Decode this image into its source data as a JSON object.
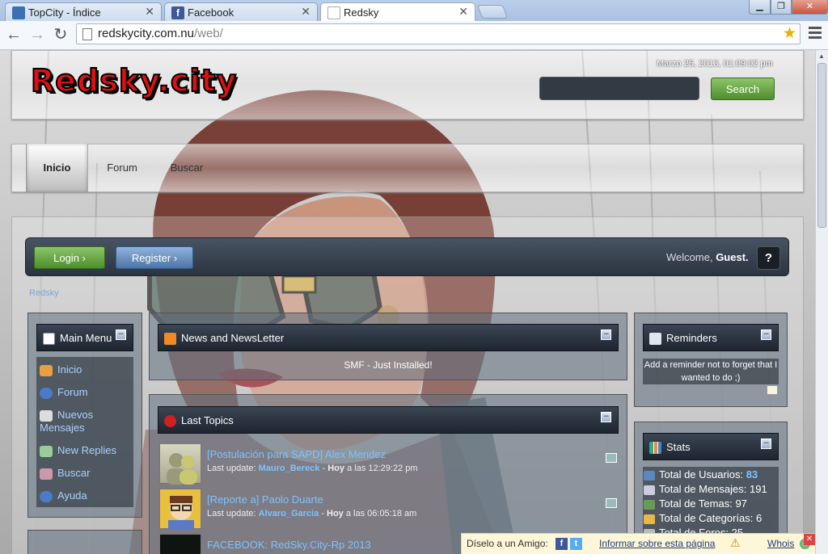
{
  "browser": {
    "tabs": [
      {
        "title": "TopCity - Índice"
      },
      {
        "title": "Facebook"
      },
      {
        "title": "Redsky"
      }
    ],
    "url_host": "redskycity.com.nu",
    "url_path": "/web/"
  },
  "site": {
    "logo_text": "Redsky.city",
    "datetime": "Marzo 25, 2013, 01:09:02 pm",
    "search_button": "Search",
    "nav": [
      "Inicio",
      "Forum",
      "Buscar"
    ],
    "login": "Login",
    "register": "Register",
    "welcome_prefix": "Welcome,",
    "welcome_user": "Guest.",
    "help": "?",
    "breadcrumb": "Redsky"
  },
  "main_menu": {
    "title": "Main Menu",
    "items": [
      "Inicio",
      "Forum",
      "Nuevos Mensajes",
      "New Replies",
      "Buscar",
      "Ayuda"
    ]
  },
  "news": {
    "title": "News and NewsLetter",
    "body": "SMF - Just Installed!"
  },
  "last_topics": {
    "title": "Last Topics",
    "items": [
      {
        "title": "[Postulación para SAPD] Alex Mendez",
        "label": "Last update:",
        "user": "Mauro_Bereck",
        "day": "Hoy",
        "time": "a las 12:29:22 pm"
      },
      {
        "title": "[Reporte a] Paolo Duarte",
        "label": "Last update:",
        "user": "Alvaro_Garcia",
        "day": "Hoy",
        "time": "a las 06:05:18 am"
      },
      {
        "title": "FACEBOOK: RedSky.City-Rp 2013"
      }
    ]
  },
  "reminders": {
    "title": "Reminders",
    "body": "Add a reminder not to forget that I wanted to do ;)"
  },
  "stats": {
    "title": "Stats",
    "rows": [
      {
        "label": "Total de Usuarios:",
        "value": "83"
      },
      {
        "label": "Total de Mensajes:",
        "value": "191"
      },
      {
        "label": "Total de Temas:",
        "value": "97"
      },
      {
        "label": "Total de Categorías:",
        "value": "6"
      },
      {
        "label": "Total de Foros:",
        "value": "25"
      }
    ]
  },
  "sharebar": {
    "share_label": "Díselo a un Amigo:",
    "report": "Informar sobre esta página",
    "whois": "Whois"
  },
  "colors": {
    "logo_red": "#e01010",
    "link_blue": "#7cc3ff",
    "green_button": "#4d8f2a",
    "blue_button": "#4d74a6"
  }
}
